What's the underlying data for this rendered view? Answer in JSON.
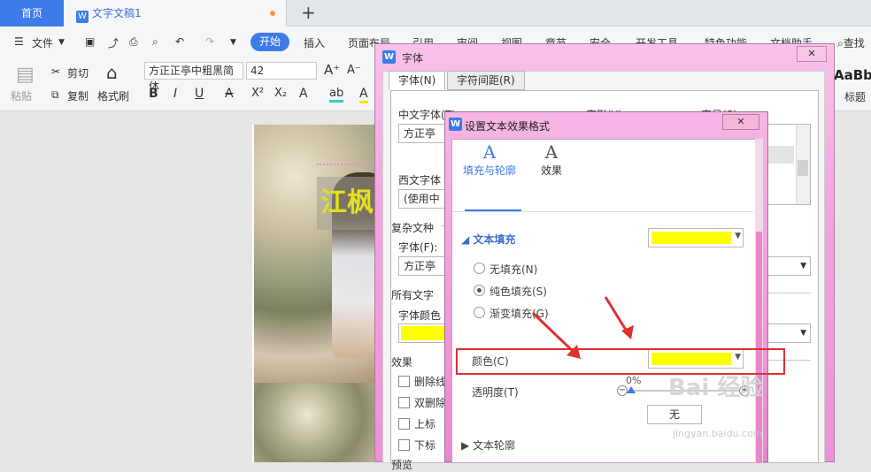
{
  "tabs": {
    "home": "首页",
    "doc": "文字文稿1",
    "add": "+"
  },
  "menu": {
    "file": "文件",
    "items": [
      "开始",
      "插入",
      "页面布局",
      "引用",
      "审阅",
      "视图",
      "章节",
      "安全",
      "开发工具",
      "特色功能",
      "文档助手"
    ],
    "find": "查找"
  },
  "ribbon": {
    "paste": "粘贴",
    "cut": "剪切",
    "copy": "复制",
    "format_painter": "格式刷",
    "font_name": "方正正亭中粗黑简体",
    "font_size": "42",
    "style_preview": "AaBb",
    "style_label": "标题"
  },
  "document": {
    "title_text": "江枫"
  },
  "font_dialog": {
    "title": "字体",
    "tabs": [
      "字体(N)",
      "字符间距(R)"
    ],
    "chinese_font_label": "中文字体(T)",
    "chinese_font_value": "方正亭",
    "style_label": "字形(Y)",
    "size_label": "字号(S)",
    "western_font_label": "西文字体",
    "western_font_value": "(使用中",
    "complex_label": "复杂文种",
    "complex_font_label": "字体(F):",
    "complex_font_value": "方正亭",
    "all_text_label": "所有文字",
    "font_color_label": "字体颜色",
    "effects_label": "效果",
    "effects": [
      "删除线",
      "双删除",
      "上标",
      "下标"
    ],
    "preview_label": "预览"
  },
  "fx_dialog": {
    "title": "设置文本效果格式",
    "tab_fill": "填充与轮廓",
    "tab_effect": "效果",
    "section_fill": "文本填充",
    "opt_none": "无填充(N)",
    "opt_solid": "纯色填充(S)",
    "opt_gradient": "渐变填充(G)",
    "color_label": "颜色(C)",
    "transparency_label": "透明度(T)",
    "transparency_value": "0%",
    "transparency_fraction": 0.0,
    "section_outline": "文本轮廓",
    "none_button": "无"
  },
  "watermark": {
    "brand": "Bai 经验",
    "url": "jingyan.baidu.com"
  },
  "colors": {
    "accent": "#3d7be8",
    "fill": "#ffff00",
    "highlight_box": "#e03030",
    "dialog_chrome": "#f3a4e0"
  }
}
